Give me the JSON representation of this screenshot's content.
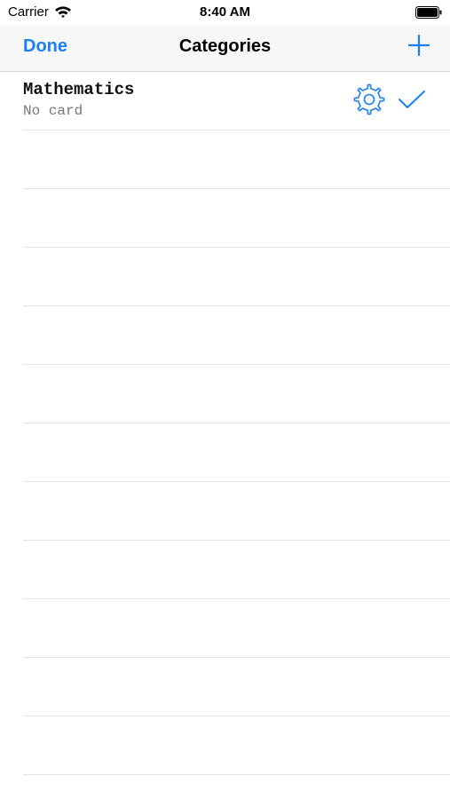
{
  "status_bar": {
    "carrier": "Carrier",
    "time": "8:40 AM",
    "wifi_icon": "wifi-icon",
    "battery_icon": "battery-icon"
  },
  "nav": {
    "done_label": "Done",
    "title": "Categories",
    "add_icon": "plus-icon"
  },
  "categories": [
    {
      "title": "Mathematics",
      "subtitle": "No card",
      "settings_icon": "gear-icon",
      "selected_icon": "checkmark-icon",
      "selected": true
    }
  ],
  "empty_row_count": 11,
  "colors": {
    "accent": "#1a80f0",
    "nav_background": "#f7f7f7",
    "separator": "#e2e2e2",
    "subtitle": "#777777"
  }
}
